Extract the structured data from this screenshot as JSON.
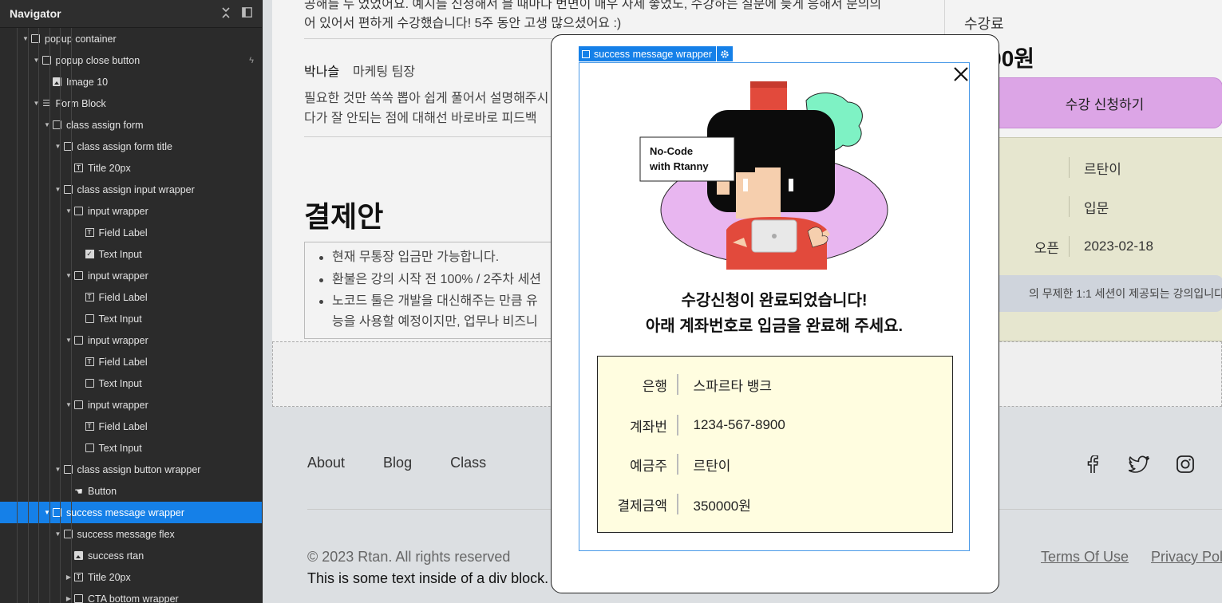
{
  "navigator": {
    "title": "Navigator",
    "items": [
      {
        "label": "popup container",
        "icon": "box",
        "depth": 0,
        "caret": "open"
      },
      {
        "label": "popup close button",
        "icon": "box",
        "depth": 1,
        "caret": "open",
        "bolt": true
      },
      {
        "label": "Image 10",
        "icon": "img",
        "depth": 2,
        "caret": "none"
      },
      {
        "label": "Form Block",
        "icon": "form",
        "depth": 1,
        "caret": "open"
      },
      {
        "label": "class assign form",
        "icon": "box",
        "depth": 2,
        "caret": "open"
      },
      {
        "label": "class assign form title",
        "icon": "box",
        "depth": 3,
        "caret": "open"
      },
      {
        "label": "Title 20px",
        "icon": "txt",
        "depth": 4,
        "caret": "none"
      },
      {
        "label": "class assign input wrapper",
        "icon": "box",
        "depth": 3,
        "caret": "open"
      },
      {
        "label": "input wrapper",
        "icon": "box",
        "depth": 4,
        "caret": "open"
      },
      {
        "label": "Field Label",
        "icon": "txt",
        "depth": 5,
        "caret": "none"
      },
      {
        "label": "Text Input",
        "icon": "chk",
        "depth": 5,
        "caret": "none"
      },
      {
        "label": "input wrapper",
        "icon": "box",
        "depth": 4,
        "caret": "open"
      },
      {
        "label": "Field Label",
        "icon": "txt",
        "depth": 5,
        "caret": "none"
      },
      {
        "label": "Text Input",
        "icon": "box",
        "depth": 5,
        "caret": "none"
      },
      {
        "label": "input wrapper",
        "icon": "box",
        "depth": 4,
        "caret": "open"
      },
      {
        "label": "Field Label",
        "icon": "txt",
        "depth": 5,
        "caret": "none"
      },
      {
        "label": "Text Input",
        "icon": "box",
        "depth": 5,
        "caret": "none"
      },
      {
        "label": "input wrapper",
        "icon": "box",
        "depth": 4,
        "caret": "open"
      },
      {
        "label": "Field Label",
        "icon": "txt",
        "depth": 5,
        "caret": "none"
      },
      {
        "label": "Text Input",
        "icon": "box",
        "depth": 5,
        "caret": "none"
      },
      {
        "label": "class assign button wrapper",
        "icon": "box",
        "depth": 3,
        "caret": "open"
      },
      {
        "label": "Button",
        "icon": "hand",
        "depth": 4,
        "caret": "none"
      },
      {
        "label": "success message wrapper",
        "icon": "box",
        "depth": 2,
        "caret": "open",
        "selected": true
      },
      {
        "label": "success message flex",
        "icon": "box",
        "depth": 3,
        "caret": "open"
      },
      {
        "label": "success rtan",
        "icon": "img",
        "depth": 4,
        "caret": "none"
      },
      {
        "label": "Title 20px",
        "icon": "txt",
        "depth": 4,
        "caret": "closed"
      },
      {
        "label": "CTA bottom wrapper",
        "icon": "box",
        "depth": 4,
        "caret": "closed"
      }
    ]
  },
  "page": {
    "review_top_lines": [
      "공해를 두 었었어요. 예시를 신청해서 블 때마다 번면이 매우 자세 좋었도, 수강하는 질문에 늦게 응해서 문의의",
      "어 있어서 편하게 수강했습니다! 5주 동안 고생 많으셨어요 :)"
    ],
    "review": {
      "name": "박나슬",
      "role": "마케팅 팀장",
      "body_lines": [
        "필요한 것만 쏙쏙 뽑아 쉽게 풀어서 설명해주시",
        "다가 잘 안되는 점에 대해선 바로바로 피드백"
      ]
    },
    "payment_heading": "결제안",
    "payment_items": [
      "현재 무통장 입금만 가능합니다.",
      "환불은 강의 시작 전 100% / 2주차 세션",
      "노코드 툴은 개발을 대신해주는 만큼 유",
      "능을 사용할 예정이지만, 업무나 비즈니"
    ],
    "side": {
      "fee_label": "수강료",
      "fee_amount": "0000원",
      "apply_button": "수강 신청하기",
      "info": [
        {
          "key": "",
          "value": "르탄이"
        },
        {
          "key": "",
          "value": "입문"
        },
        {
          "key": "오픈",
          "value": "2023-02-18"
        }
      ],
      "note": "의 무제한 1:1 세션이 제공되는 강의입니다."
    },
    "footer": {
      "links": [
        "About",
        "Blog",
        "Class"
      ],
      "social_icons": [
        "facebook-icon",
        "twitter-icon",
        "instagram-icon"
      ],
      "copyright": "© 2023 Rtan. All rights reserved",
      "div_text": "This is some text inside of a div block.",
      "legal": [
        "Terms Of Use",
        "Privacy Pol"
      ]
    }
  },
  "modal": {
    "selection_label": "success message wrapper",
    "illustration_caption_line1": "No-Code",
    "illustration_caption_line2": "with Rtanny",
    "success_line1": "수강신청이 완료되었습니다!",
    "success_line2": "아래 계좌번호로 입금을 완료해 주세요.",
    "account": [
      {
        "key": "은행",
        "value": "스파르타 뱅크"
      },
      {
        "key": "계좌번",
        "value": "1234-567-8900"
      },
      {
        "key": "예금주",
        "value": "르탄이"
      },
      {
        "key": "결제금액",
        "value": "350000원"
      }
    ]
  },
  "colors": {
    "selection_blue": "#1580e8",
    "apply_button": "#dca5e6",
    "info_card": "#e6e6cf",
    "account_box": "#fffde0"
  }
}
